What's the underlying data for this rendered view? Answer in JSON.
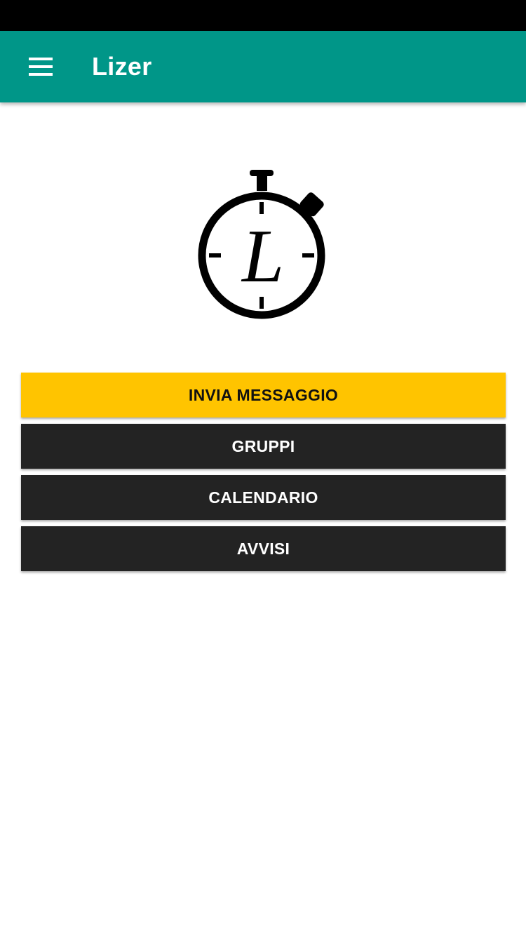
{
  "app_bar": {
    "title": "Lizer",
    "background_color": "#009688",
    "menu_icon": "hamburger-menu-icon"
  },
  "logo": {
    "icon": "stopwatch-logo-icon",
    "letter": "L"
  },
  "buttons": [
    {
      "label": "INVIA MESSAGGIO",
      "color": "#ffc400"
    },
    {
      "label": "GRUPPI",
      "color": "#232323"
    },
    {
      "label": "CALENDARIO",
      "color": "#232323"
    },
    {
      "label": "AVVISI",
      "color": "#232323"
    }
  ]
}
